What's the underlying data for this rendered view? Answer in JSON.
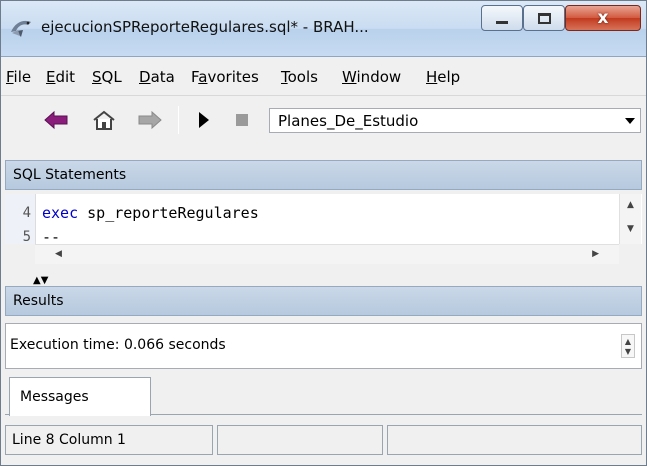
{
  "window": {
    "title": "ejecucionSPReporteRegulares.sql* - BRAH...",
    "close_symbol": "x"
  },
  "menu": {
    "items": [
      {
        "accel": "F",
        "rest": "ile"
      },
      {
        "accel": "E",
        "rest": "dit"
      },
      {
        "accel": "S",
        "rest": "QL"
      },
      {
        "accel": "D",
        "rest": "ata"
      },
      {
        "pre": "F",
        "accel": "a",
        "rest": "vorites"
      },
      {
        "accel": "T",
        "rest": "ools"
      },
      {
        "accel": "W",
        "rest": "indow"
      },
      {
        "accel": "H",
        "rest": "elp"
      }
    ]
  },
  "toolbar": {
    "database": "Planes_De_Estudio"
  },
  "sql_panel": {
    "header": "SQL Statements",
    "lines": [
      {
        "number": "4",
        "keyword": "exec",
        "text": " sp_reporteRegulares"
      },
      {
        "number": "5",
        "keyword": "",
        "text": "--"
      }
    ]
  },
  "results_panel": {
    "header": "Results",
    "message": "Execution time: 0.066 seconds",
    "tab": "Messages"
  },
  "status": {
    "position": "Line 8   Column 1",
    "panel2": "",
    "panel3": ""
  },
  "colors": {
    "keyword": "#0000cc",
    "header_bg": "#b6c9de",
    "titlebar_bg": "#c9dcf1",
    "close_button": "#c23a1f"
  }
}
